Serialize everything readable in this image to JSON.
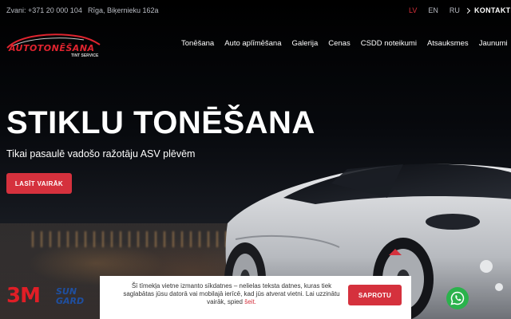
{
  "topbar": {
    "phone": "Zvani: +371 20 000 104",
    "address": "Rīga, Biķernieku 162a",
    "languages": [
      {
        "code": "LV",
        "active": true
      },
      {
        "code": "EN",
        "active": false
      },
      {
        "code": "RU",
        "active": false
      }
    ],
    "contacts_label": "KONTAKTI"
  },
  "logo": {
    "wordmark": "AUTOTONĒŠANA",
    "tagline": "TINT SERVICE"
  },
  "nav": {
    "items": [
      "Tonēšana",
      "Auto aplīmēšana",
      "Galerija",
      "Cenas",
      "CSDD noteikumi",
      "Atsauksmes",
      "Jaunumi"
    ]
  },
  "hero": {
    "title": "STIKLU TONĒŠANA",
    "subtitle": "Tikai pasaulē vadošo ražotāju ASV plēvēm",
    "button_label": "LASĪT VAIRĀK"
  },
  "brands": {
    "brand_1": "3M",
    "brand_2_line1": "SUN",
    "brand_2_line2": "GARD"
  },
  "cookie": {
    "text": "Šī tīmekļa vietne izmanto sīkdatnes – nelielas teksta datnes, kuras tiek saglabātas jūsu datorā vai mobilajā ierīcē, kad jūs atverat vietni. Lai uzzinātu vairāk, spied",
    "link_text": "šeit.",
    "button_label": "SAPROTU"
  },
  "colors": {
    "accent": "#d5313d",
    "whatsapp": "#2bb24c"
  },
  "icons": {
    "contacts": "chevron-right-icon",
    "chat": "whatsapp-icon"
  }
}
